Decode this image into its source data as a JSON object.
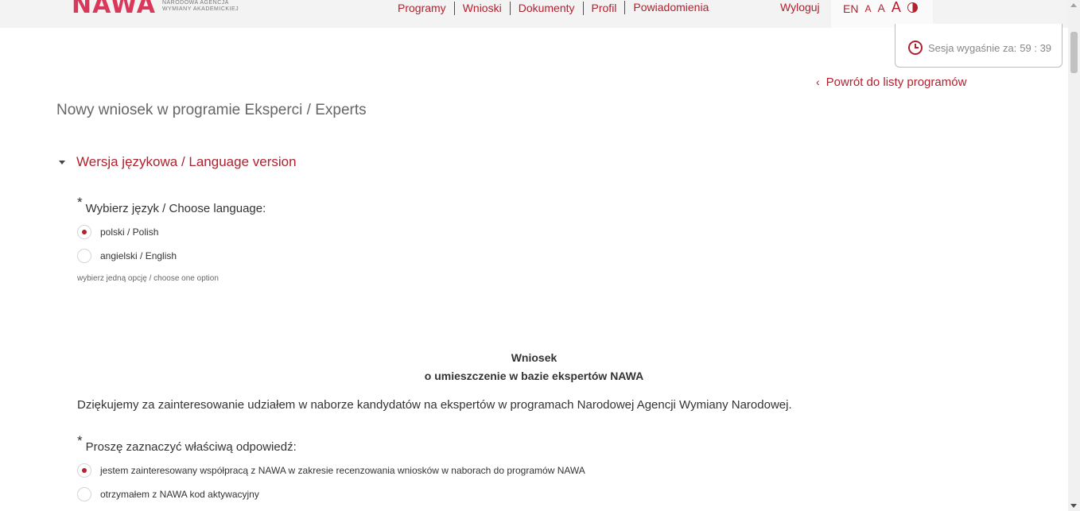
{
  "header": {
    "logo_text": "NAWA",
    "logo_subtitle_line1": "Narodowa Agencja",
    "logo_subtitle_line2": "Wymiany Akademickiej",
    "nav": [
      "Programy",
      "Wnioski",
      "Dokumenty",
      "Profil",
      "Powiadomienia"
    ],
    "logout": "Wyloguj",
    "lang_switch": "EN",
    "font_small": "A",
    "font_medium": "A",
    "font_large": "A",
    "contrast_icon": "contrast-icon"
  },
  "session": {
    "label": "Sesja wygaśnie za:",
    "time": "59 : 39"
  },
  "back_link": "Powrót do listy programów",
  "page_title": "Nowy wniosek w programie Eksperci / Experts",
  "language_section": {
    "title": "Wersja językowa / Language version",
    "question": "Wybierz język / Choose language:",
    "options": [
      "polski / Polish",
      "angielski / English"
    ],
    "selected_index": 0,
    "hint": "wybierz jedną opcję / choose one option"
  },
  "form": {
    "heading_line1": "Wniosek",
    "heading_line2": "o umieszczenie w bazie ekspertów NAWA",
    "intro": "Dziękujemy za zainteresowanie udziałem w naborze kandydatów na ekspertów w programach Narodowej Agencji Wymiany Narodowej.",
    "question": "Proszę zaznaczyć właściwą odpowiedź:",
    "options": [
      "jestem zainteresowany współpracą z NAWA w zakresie recenzowania wniosków w naborach do programów NAWA",
      "otrzymałem z NAWA kod aktywacyjny"
    ],
    "selected_index": 0
  },
  "colors": {
    "accent": "#b3202e",
    "logo": "#d9385a",
    "header_bg": "#f3f3f3"
  }
}
